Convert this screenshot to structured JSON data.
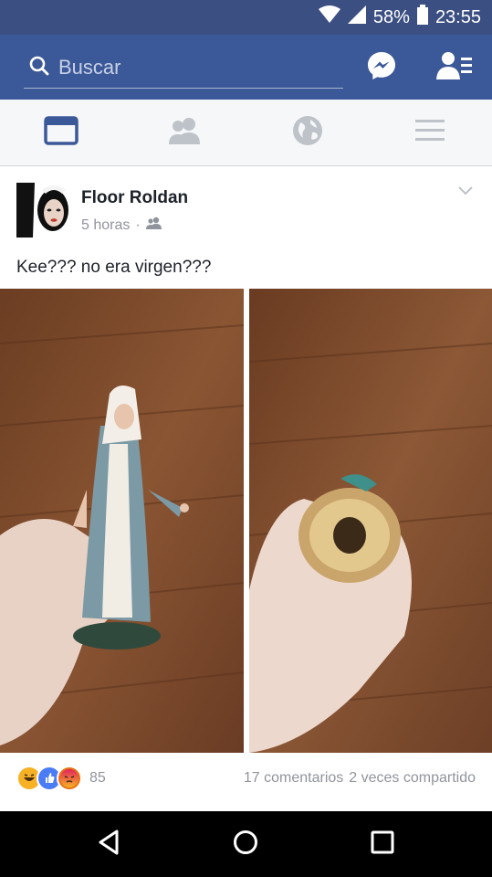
{
  "status_bar": {
    "battery": "58%",
    "time": "23:55"
  },
  "app_bar": {
    "search_placeholder": "Buscar"
  },
  "tabs": [
    {
      "name": "news-feed",
      "active": true
    },
    {
      "name": "friends",
      "active": false
    },
    {
      "name": "notifications-globe",
      "active": false
    },
    {
      "name": "menu",
      "active": false
    }
  ],
  "post": {
    "author": "Floor Roldan",
    "time": "5 horas",
    "text": "Kee??? no era virgen???",
    "reactions": {
      "count": "85",
      "types": [
        "haha",
        "like",
        "angry"
      ]
    },
    "comments": "17 comentarios",
    "shares": "2 veces compartido"
  },
  "colors": {
    "brand": "#3b5998",
    "status_bar": "#3b4f83",
    "tab_active": "#3b5998",
    "tab_inactive": "#bec3c9"
  }
}
